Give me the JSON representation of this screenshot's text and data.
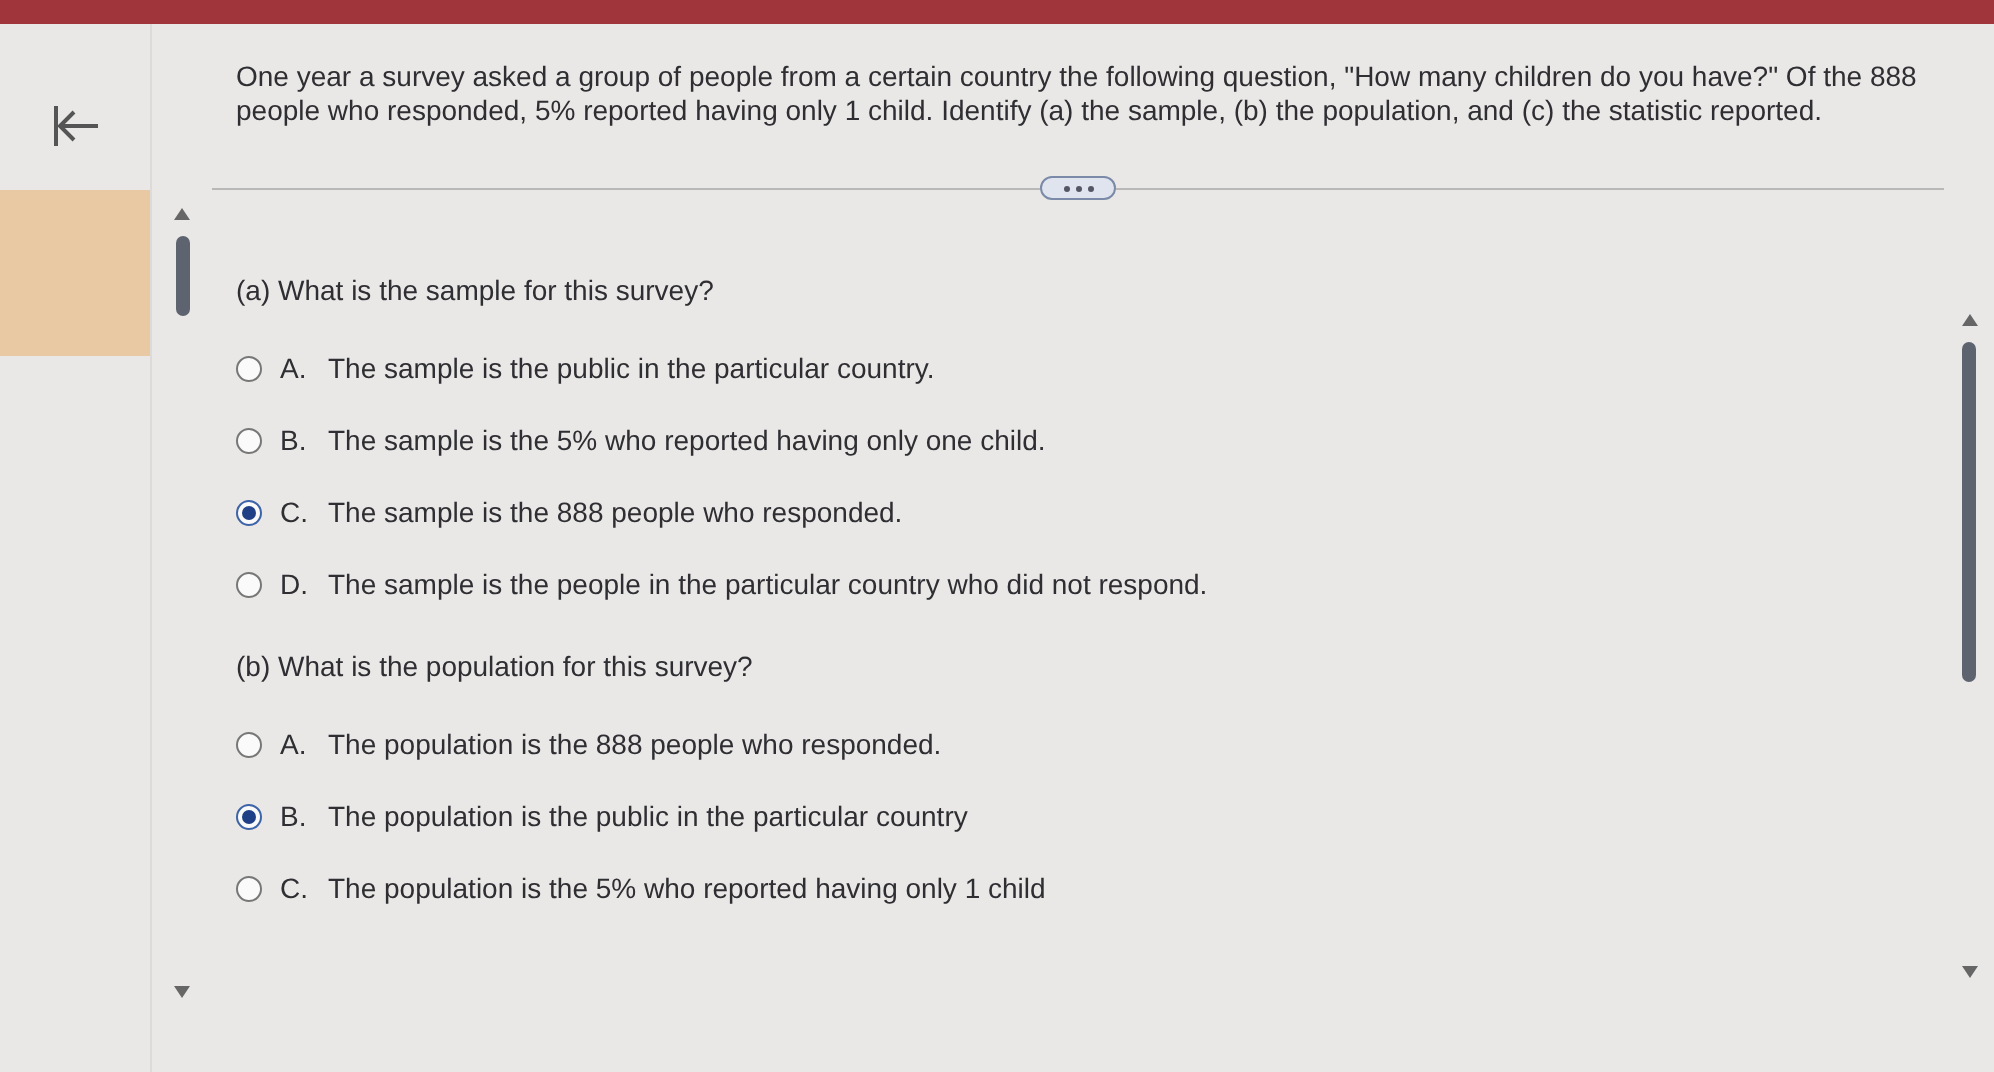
{
  "question": "One year a survey asked a group of people from a certain country the following question, \"How many children do you have?\" Of the 888 people who responded, 5% reported having only 1 child. Identify (a) the sample, (b) the population, and (c) the statistic reported.",
  "parts": [
    {
      "prompt": "(a) What is the sample for this survey?",
      "options": [
        {
          "letter": "A.",
          "text": "The sample is the public in the particular country.",
          "selected": false
        },
        {
          "letter": "B.",
          "text": "The sample is the 5% who reported having only one child.",
          "selected": false
        },
        {
          "letter": "C.",
          "text": "The sample is the 888 people who responded.",
          "selected": true
        },
        {
          "letter": "D.",
          "text": "The sample is the people in the particular country who did not respond.",
          "selected": false
        }
      ]
    },
    {
      "prompt": "(b) What is the population for this survey?",
      "options": [
        {
          "letter": "A.",
          "text": "The population is the 888 people who responded.",
          "selected": false
        },
        {
          "letter": "B.",
          "text": "The population is the public in the particular country",
          "selected": true
        },
        {
          "letter": "C.",
          "text": "The population is the 5% who reported having only 1 child",
          "selected": false
        }
      ]
    }
  ]
}
